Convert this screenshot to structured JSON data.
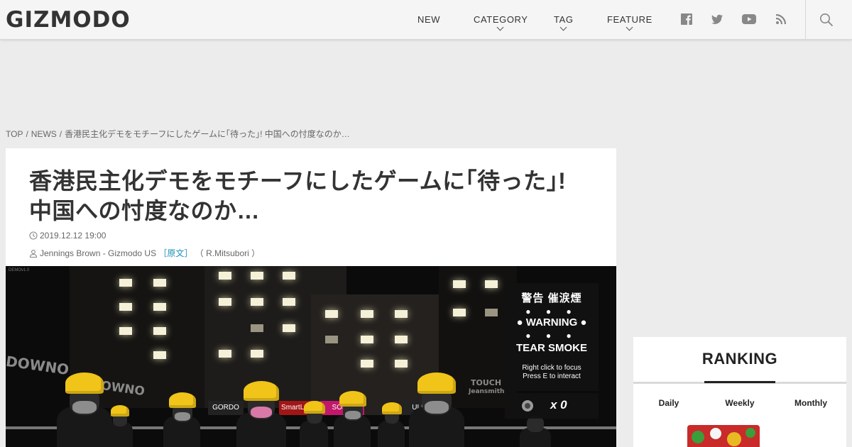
{
  "header": {
    "logo": "GIZMODO",
    "nav": [
      {
        "label": "NEW"
      },
      {
        "label": "CATEGORY"
      },
      {
        "label": "TAG"
      },
      {
        "label": "FEATURE"
      }
    ],
    "social_icons": [
      "facebook-icon",
      "twitter-icon",
      "youtube-icon",
      "rss-icon"
    ],
    "search_icon": "search-icon"
  },
  "breadcrumb": {
    "items": [
      "TOP",
      "NEWS",
      "香港民主化デモをモチーフにしたゲームに｢待った｣! 中国への忖度なのか…"
    ],
    "separator": "/"
  },
  "article": {
    "title_line1": "香港民主化デモをモチーフにしたゲームに｢待った｣!",
    "title_line2": "中国への忖度なのか…",
    "date": "2019.12.12 19:00",
    "author": "Jennings Brown - Gizmodo US",
    "original_link": "［原文］",
    "translator": "（ R.Mitsubori ）"
  },
  "hero": {
    "demo_tag": "DEMOv1.0",
    "warning_jp": "警告 催涙煙",
    "warning_dots": "● ● ●",
    "warning_en": "● WARNING ●",
    "tear_smoke": "TEAR SMOKE",
    "hint_line1": "Right click to focus",
    "hint_line2": "Press E to interact",
    "counter": "x 0",
    "sign_left": "DOWNO",
    "sign_mid": "DOWNO",
    "sign_touch": "TOUCH",
    "sign_touch2": "Jeansmith",
    "shops": [
      "GORDO",
      "SmartLone",
      "SOSO",
      "ULI"
    ]
  },
  "ranking": {
    "title": "RANKING",
    "tabs": [
      "Daily",
      "Weekly",
      "Monthly"
    ],
    "active_tab": "Weekly"
  },
  "colors": {
    "header_bg": "#f5f5f5",
    "page_bg": "#ececec",
    "link": "#1a8fb8",
    "helmet": "#f0c419"
  }
}
